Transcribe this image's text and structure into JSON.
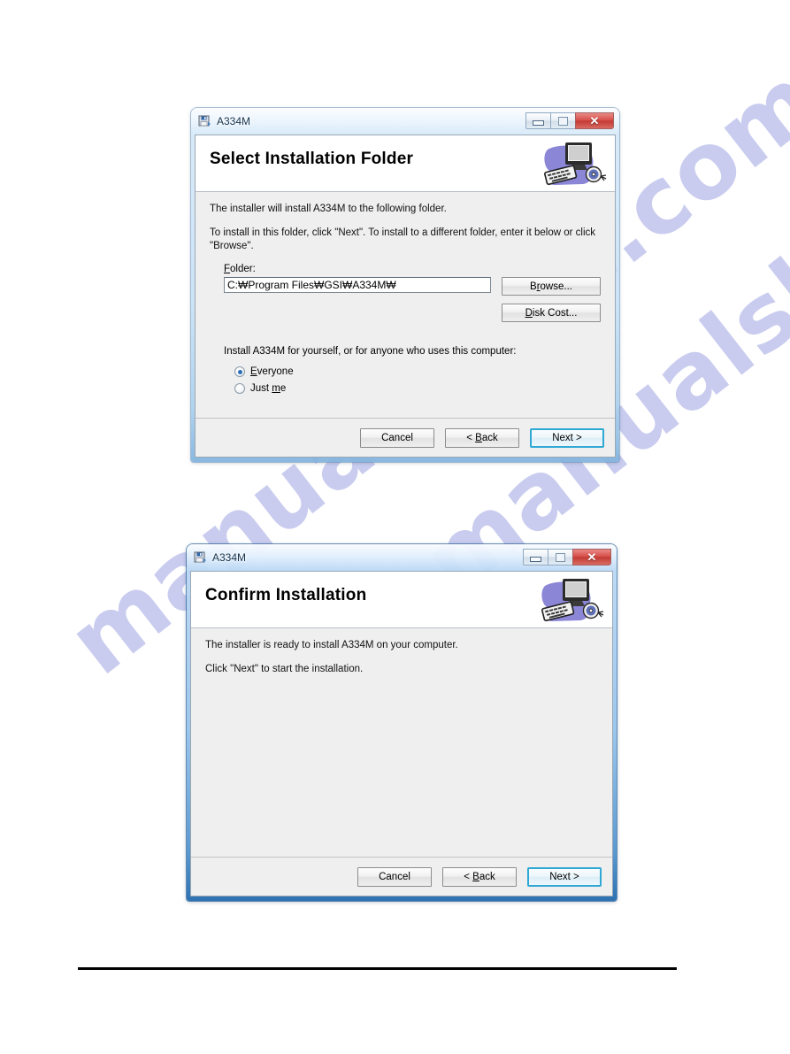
{
  "page": {
    "background_color": "#ffffff",
    "rule_color": "#000000",
    "watermark": {
      "text_left": "manualshive.com",
      "text_right": "manualshive.com",
      "color": "#a9aee4"
    }
  },
  "dialogs": [
    {
      "id": "select-installation-folder",
      "window_title": "A334M",
      "app_icon": "installer-floppy-icon",
      "window_controls": {
        "minimize": "minimize-icon",
        "maximize": "maximize-icon",
        "close": "✕"
      },
      "header": {
        "title": "Select Installation Folder",
        "art": "computer-keyboard-cd-icon"
      },
      "body": {
        "paragraph1": "The installer will install A334M to the following folder.",
        "paragraph2": "To install in this folder, click \"Next\". To install to a different folder, enter it below or click \"Browse\".",
        "folder_label": "Folder:",
        "folder_label_accel": "F",
        "folder_value": "C:₩Program Files₩GSI₩A334M₩",
        "browse_label": "Browse...",
        "browse_accel": "r",
        "disk_cost_label": "Disk Cost...",
        "disk_cost_accel": "D",
        "choice_prompt": "Install A334M for yourself, or for anyone who uses this computer:",
        "options": [
          {
            "label": "Everyone",
            "accel": "E",
            "selected": true
          },
          {
            "label": "Just me",
            "accel": "m",
            "selected": false
          }
        ]
      },
      "footer": {
        "cancel": "Cancel",
        "back": "< Back",
        "back_accel": "B",
        "next": "Next >",
        "next_is_default": true,
        "default_border_color": "#2fa8d5"
      }
    },
    {
      "id": "confirm-installation",
      "window_title": "A334M",
      "app_icon": "installer-floppy-icon",
      "window_controls": {
        "minimize": "minimize-icon",
        "maximize": "maximize-icon",
        "close": "✕"
      },
      "header": {
        "title": "Confirm Installation",
        "art": "computer-keyboard-cd-icon"
      },
      "body": {
        "paragraph1": "The installer is ready to install A334M on your computer.",
        "paragraph2": "Click \"Next\" to start the installation."
      },
      "footer": {
        "cancel": "Cancel",
        "back": "< Back",
        "back_accel": "B",
        "next": "Next >",
        "next_is_default": true,
        "default_border_color": "#2fa8d5"
      }
    }
  ]
}
